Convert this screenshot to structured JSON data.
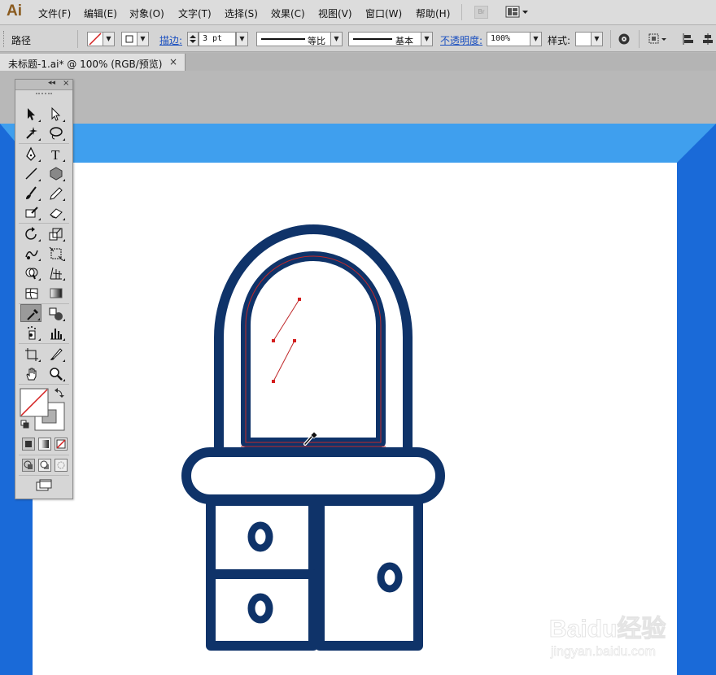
{
  "app": {
    "logo": "Ai"
  },
  "menu": [
    "文件(F)",
    "编辑(E)",
    "对象(O)",
    "文字(T)",
    "选择(S)",
    "效果(C)",
    "视图(V)",
    "窗口(W)",
    "帮助(H)"
  ],
  "bridge_button": "Br",
  "control_bar": {
    "selection_type": "路径",
    "stroke_label": "描边:",
    "stroke_weight": "3 pt",
    "stroke_profile": "等比",
    "brush": "基本",
    "opacity_label": "不透明度:",
    "opacity_value": "100%",
    "style_label": "样式:"
  },
  "document_tab": {
    "title": "未标题-1.ai* @ 100% (RGB/预览)",
    "close": "×"
  },
  "tools_panel": {
    "collapse": "◂◂",
    "close": "×"
  },
  "tools": [
    "selection-tool",
    "direct-selection-tool",
    "magic-wand-tool",
    "lasso-tool",
    "pen-tool",
    "type-tool",
    "line-tool",
    "polygon-tool",
    "paintbrush-tool",
    "pencil-tool",
    "blob-brush-tool",
    "eraser-tool",
    "rotate-tool",
    "scale-tool",
    "warp-tool",
    "free-transform-tool",
    "shape-builder-tool",
    "perspective-grid-tool",
    "mesh-tool",
    "gradient-tool",
    "eyedropper-tool",
    "blend-tool",
    "symbol-sprayer-tool",
    "column-graph-tool",
    "artboard-tool",
    "slice-tool",
    "hand-tool",
    "zoom-tool"
  ],
  "colors": {
    "artwork_stroke": "#0f3369",
    "frame_blue_top": "#3f9fee",
    "frame_blue_side": "#1a6ad8",
    "selection_path": "#c0282a",
    "artboard": "#ffffff"
  },
  "watermark": {
    "brand": "Baidu经验",
    "url": "jingyan.baidu.com"
  }
}
